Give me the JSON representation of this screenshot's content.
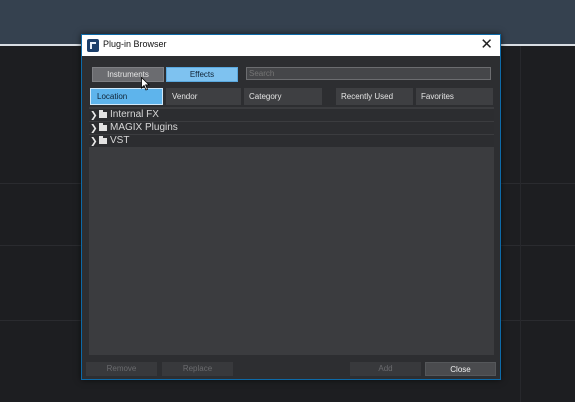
{
  "dialog": {
    "title": "Plug-in Browser",
    "close_glyph": "✕"
  },
  "toolbar": {
    "instruments_label": "Instruments",
    "effects_label": "Effects",
    "search_placeholder": "Search"
  },
  "tabs": [
    {
      "label": "Location",
      "active": true
    },
    {
      "label": "Vendor",
      "active": false
    },
    {
      "label": "Category",
      "active": false
    },
    {
      "label": "Recently Used",
      "active": false
    },
    {
      "label": "Favorites",
      "active": false
    }
  ],
  "tree": [
    {
      "label": "Internal FX",
      "icon": "folder-icon"
    },
    {
      "label": "MAGIX Plugins",
      "icon": "folder-icon"
    },
    {
      "label": "VST",
      "icon": "folder-icon"
    }
  ],
  "footer": {
    "remove_label": "Remove",
    "replace_label": "Replace",
    "add_label": "Add",
    "close_label": "Close"
  },
  "colors": {
    "accent": "#5eb4ec",
    "dialog_border": "#0d6aa8",
    "dialog_bg": "#2d2e31"
  }
}
